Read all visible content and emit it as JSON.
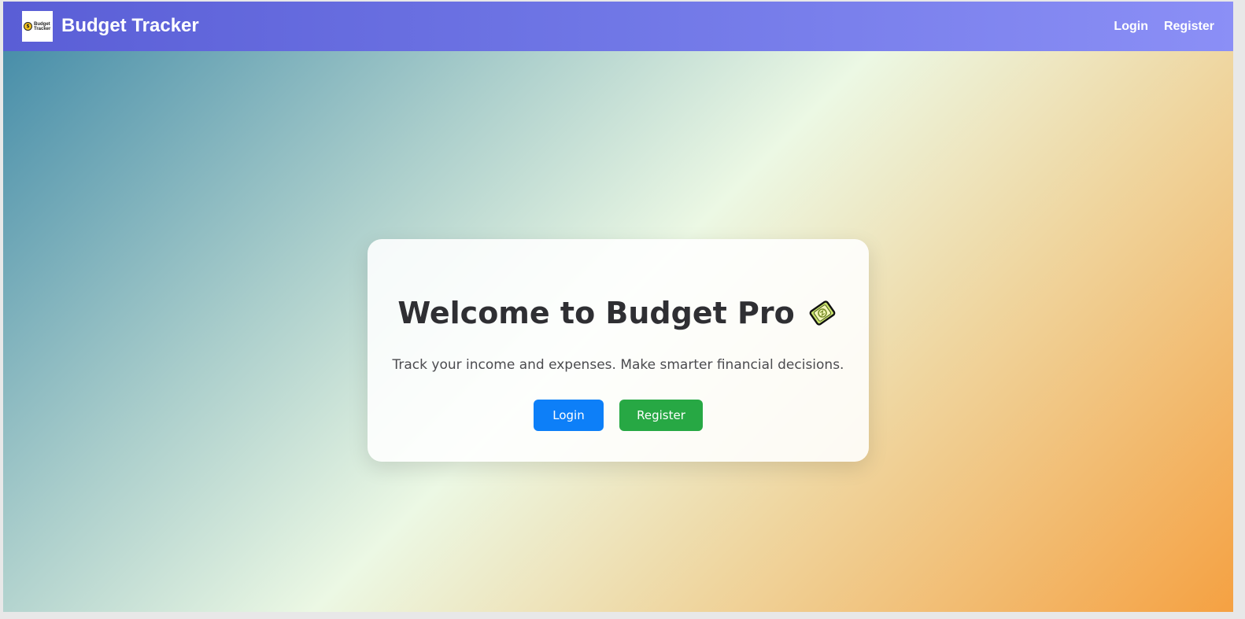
{
  "navbar": {
    "logo_text": "Budget Tracker",
    "logo_coin_symbol": "$",
    "brand": "Budget Tracker",
    "links": [
      {
        "label": "Login"
      },
      {
        "label": "Register"
      }
    ],
    "gradient_colors": [
      "#5a5ed6",
      "#8b8ff6"
    ]
  },
  "hero": {
    "title": "Welcome to Budget Pro",
    "title_icon": "money-tag-icon",
    "subtitle": "Track your income and expenses. Make smarter financial decisions.",
    "login_button": "Login",
    "register_button": "Register",
    "login_color": "#0d7ff8",
    "register_color": "#27a844"
  },
  "background": {
    "gradient_colors": [
      "#3f88a6",
      "#ecf8e4",
      "#f5a142"
    ]
  }
}
